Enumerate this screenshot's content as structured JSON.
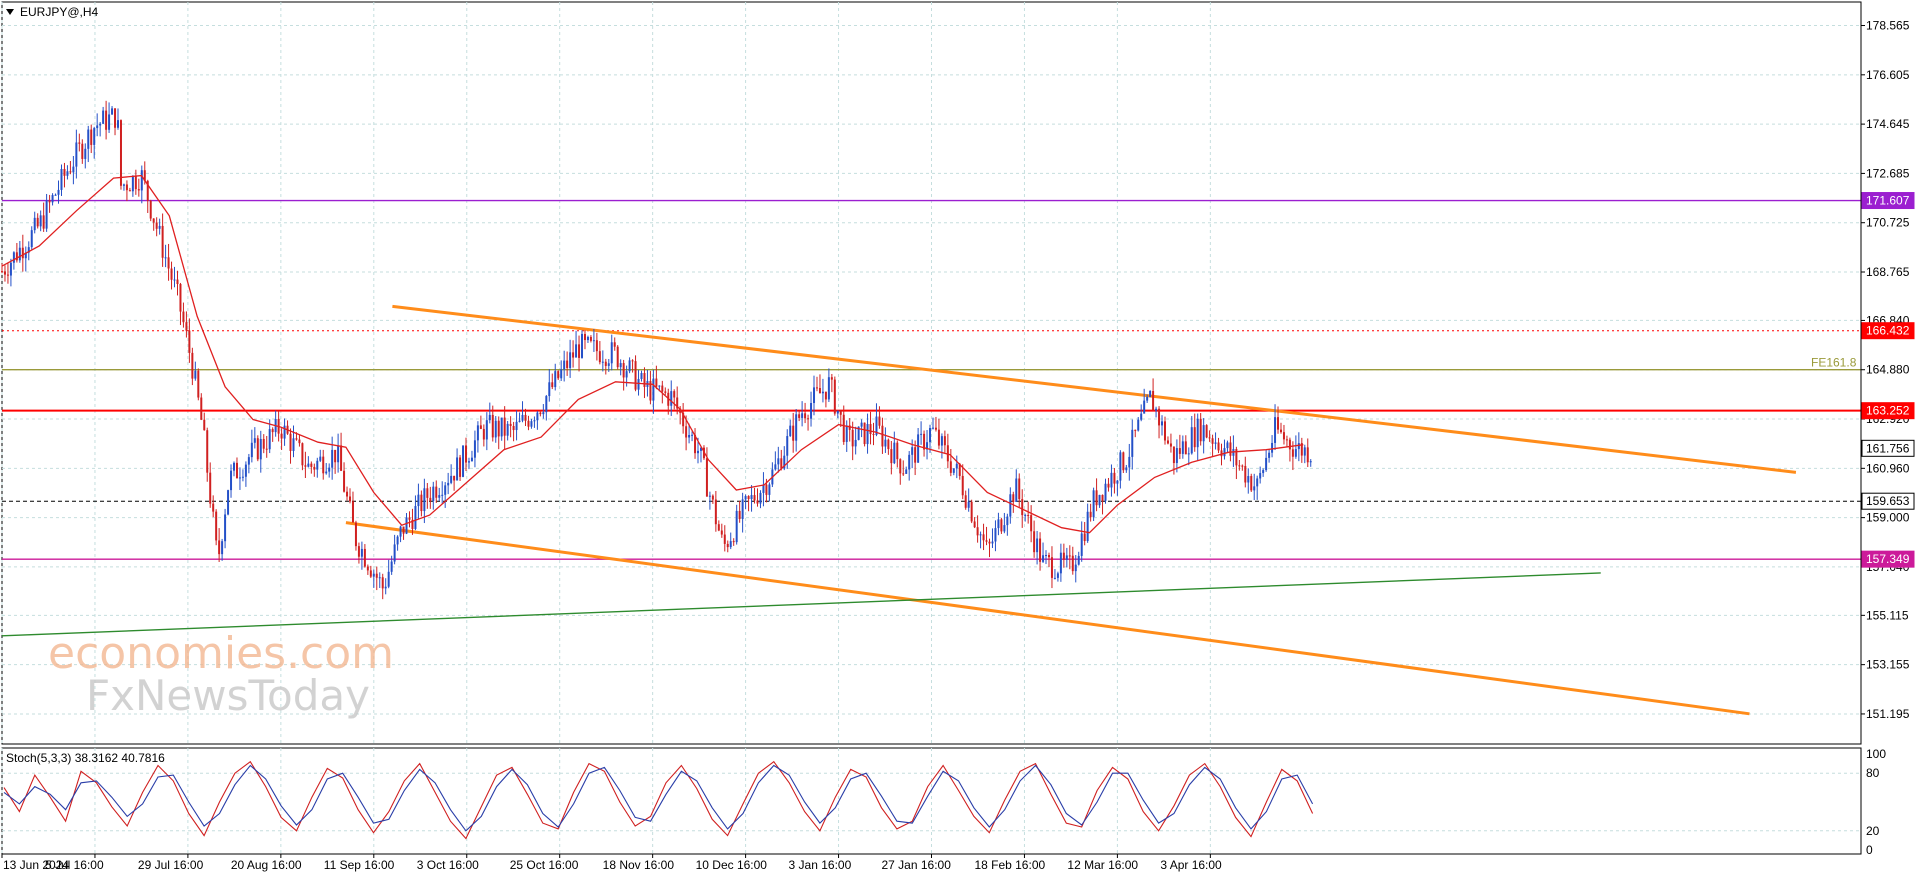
{
  "window": {
    "symbol_label": "EURJPY@,H4",
    "collapse_icon": "triangle-down-icon"
  },
  "watermark": {
    "line1": "economies.com",
    "line2": "FxNewsToday"
  },
  "colors": {
    "background": "#ffffff",
    "grid": "#c5dede",
    "bull_candle": "#2450c8",
    "bear_candle": "#d02020",
    "moving_average": "#e02020",
    "channel": "#ff8c1a",
    "support_trend": "#2e8b2e",
    "level_purple": "#9b1fd0",
    "level_red": "#ff0000",
    "level_magenta": "#cc1a9a",
    "level_olive": "#9a9a3a",
    "stoch_main": "#d02020",
    "stoch_signal": "#2a3ea8"
  },
  "chart_data": [
    {
      "type": "candlestick",
      "title": "EURJPY@,H4",
      "ylim": [
        150.0,
        179.5
      ],
      "xlim": [
        0,
        100
      ],
      "y_ticks": [
        178.565,
        176.605,
        174.645,
        172.685,
        170.725,
        168.765,
        166.84,
        164.88,
        162.92,
        160.96,
        159.0,
        157.04,
        155.115,
        153.155,
        151.195
      ],
      "x_tick_positions": [
        0,
        5,
        10,
        15,
        20,
        25,
        30,
        35,
        40,
        45,
        50,
        55,
        60,
        65
      ],
      "x_tick_labels": [
        "13 Jun 2024",
        "5 Jul 16:00",
        "29 Jul 16:00",
        "20 Aug 16:00",
        "11 Sep 16:00",
        "3 Oct 16:00",
        "25 Oct 16:00",
        "18 Nov 16:00",
        "10 Dec 16:00",
        "3 Jan 16:00",
        "27 Jan 16:00",
        "18 Feb 16:00",
        "12 Mar 16:00",
        "3 Apr 16:00"
      ],
      "price_path": [
        {
          "x": 0,
          "y": 168.8
        },
        {
          "x": 2,
          "y": 170.6
        },
        {
          "x": 3.5,
          "y": 172.8
        },
        {
          "x": 5,
          "y": 174.6
        },
        {
          "x": 6.2,
          "y": 175.0
        },
        {
          "x": 6.4,
          "y": 172.2
        },
        {
          "x": 7.5,
          "y": 172.6
        },
        {
          "x": 8.3,
          "y": 170.6
        },
        {
          "x": 9.5,
          "y": 167.6
        },
        {
          "x": 10.2,
          "y": 165.2
        },
        {
          "x": 10.8,
          "y": 162.5
        },
        {
          "x": 11.6,
          "y": 157.2
        },
        {
          "x": 12.2,
          "y": 160.5
        },
        {
          "x": 13.5,
          "y": 161.6
        },
        {
          "x": 15,
          "y": 162.6
        },
        {
          "x": 16.5,
          "y": 161.0
        },
        {
          "x": 18,
          "y": 161.6
        },
        {
          "x": 19,
          "y": 158.2
        },
        {
          "x": 20.5,
          "y": 156.2
        },
        {
          "x": 21.5,
          "y": 158.5
        },
        {
          "x": 23,
          "y": 160.0
        },
        {
          "x": 24.5,
          "y": 161.0
        },
        {
          "x": 26,
          "y": 162.6
        },
        {
          "x": 27.5,
          "y": 162.4
        },
        {
          "x": 29,
          "y": 163.5
        },
        {
          "x": 31,
          "y": 165.8
        },
        {
          "x": 33,
          "y": 165.5
        },
        {
          "x": 34.5,
          "y": 164.2
        },
        {
          "x": 36,
          "y": 163.8
        },
        {
          "x": 37.5,
          "y": 161.6
        },
        {
          "x": 38.8,
          "y": 157.8
        },
        {
          "x": 40,
          "y": 159.4
        },
        {
          "x": 41.5,
          "y": 160.8
        },
        {
          "x": 43,
          "y": 163.2
        },
        {
          "x": 44.5,
          "y": 164.3
        },
        {
          "x": 45.5,
          "y": 162.0
        },
        {
          "x": 47,
          "y": 162.6
        },
        {
          "x": 48.5,
          "y": 161.0
        },
        {
          "x": 50,
          "y": 162.5
        },
        {
          "x": 51.5,
          "y": 160.6
        },
        {
          "x": 53,
          "y": 157.6
        },
        {
          "x": 54.5,
          "y": 160.2
        },
        {
          "x": 56,
          "y": 157.2
        },
        {
          "x": 57.5,
          "y": 157.0
        },
        {
          "x": 58.8,
          "y": 159.8
        },
        {
          "x": 60.5,
          "y": 161.4
        },
        {
          "x": 61.8,
          "y": 163.8
        },
        {
          "x": 63,
          "y": 161.4
        },
        {
          "x": 64.5,
          "y": 162.6
        },
        {
          "x": 66,
          "y": 161.6
        },
        {
          "x": 67.5,
          "y": 160.2
        },
        {
          "x": 68.5,
          "y": 162.5
        },
        {
          "x": 69.5,
          "y": 161.8
        },
        {
          "x": 70.5,
          "y": 161.6
        }
      ],
      "moving_average": [
        {
          "x": 0,
          "y": 169.0
        },
        {
          "x": 2,
          "y": 169.8
        },
        {
          "x": 4,
          "y": 171.2
        },
        {
          "x": 6,
          "y": 172.5
        },
        {
          "x": 7.5,
          "y": 172.6
        },
        {
          "x": 9,
          "y": 171.0
        },
        {
          "x": 10.5,
          "y": 167.0
        },
        {
          "x": 12,
          "y": 164.2
        },
        {
          "x": 13.5,
          "y": 162.9
        },
        {
          "x": 15,
          "y": 162.6
        },
        {
          "x": 17,
          "y": 162.0
        },
        {
          "x": 18.5,
          "y": 161.8
        },
        {
          "x": 20,
          "y": 160.0
        },
        {
          "x": 21.5,
          "y": 158.7
        },
        {
          "x": 23,
          "y": 159.1
        },
        {
          "x": 25,
          "y": 160.4
        },
        {
          "x": 27,
          "y": 161.7
        },
        {
          "x": 29,
          "y": 162.2
        },
        {
          "x": 31,
          "y": 163.7
        },
        {
          "x": 33,
          "y": 164.4
        },
        {
          "x": 35,
          "y": 164.3
        },
        {
          "x": 36.5,
          "y": 163.3
        },
        {
          "x": 38,
          "y": 161.3
        },
        {
          "x": 39.5,
          "y": 160.1
        },
        {
          "x": 41,
          "y": 160.3
        },
        {
          "x": 43,
          "y": 161.7
        },
        {
          "x": 45,
          "y": 162.7
        },
        {
          "x": 47,
          "y": 162.4
        },
        {
          "x": 49,
          "y": 161.9
        },
        {
          "x": 51,
          "y": 161.5
        },
        {
          "x": 53,
          "y": 160.0
        },
        {
          "x": 55,
          "y": 159.3
        },
        {
          "x": 57,
          "y": 158.6
        },
        {
          "x": 58.5,
          "y": 158.4
        },
        {
          "x": 60,
          "y": 159.5
        },
        {
          "x": 62,
          "y": 160.6
        },
        {
          "x": 64,
          "y": 161.2
        },
        {
          "x": 66,
          "y": 161.6
        },
        {
          "x": 68,
          "y": 161.7
        },
        {
          "x": 70,
          "y": 161.9
        }
      ],
      "horizontal_levels": [
        {
          "price": "171.607",
          "value": 171.607,
          "style": "solid",
          "color": "#9b1fd0"
        },
        {
          "price": "166.432",
          "value": 166.432,
          "style": "dotted",
          "color": "#ff0000"
        },
        {
          "price": "FE161.8",
          "value": 164.88,
          "style": "solid",
          "color": "#9a9a3a"
        },
        {
          "price": "163.252",
          "value": 163.252,
          "style": "solid",
          "color": "#ff0000"
        },
        {
          "price": "161.756",
          "value": 161.756,
          "style": "tag",
          "color": "#000000"
        },
        {
          "price": "159.653",
          "value": 159.653,
          "style": "dashed",
          "color": "#000000"
        },
        {
          "price": "157.349",
          "value": 157.349,
          "style": "solid",
          "color": "#cc1a9a"
        }
      ],
      "trend_lines": [
        {
          "role": "channel-upper",
          "from": {
            "x": 21,
            "y": 167.4
          },
          "to": {
            "x": 96.5,
            "y": 160.8
          }
        },
        {
          "role": "channel-lower",
          "from": {
            "x": 18.5,
            "y": 158.8
          },
          "to": {
            "x": 94,
            "y": 151.2
          }
        },
        {
          "role": "support-trend",
          "from": {
            "x": 0,
            "y": 154.3
          },
          "to": {
            "x": 86,
            "y": 156.8
          }
        }
      ],
      "grid": true
    },
    {
      "type": "line",
      "title": "Stoch(5,3,3) 38.3162 40.7816",
      "ylim": [
        0,
        100
      ],
      "y_ticks": [
        0,
        20,
        80,
        100
      ],
      "series": [
        {
          "values": [
            65,
            40,
            78,
            55,
            30,
            82,
            70,
            45,
            25,
            60,
            88,
            72,
            38,
            15,
            50,
            80,
            92,
            66,
            34,
            20,
            55,
            85,
            75,
            42,
            18,
            40,
            72,
            90,
            60,
            30,
            12,
            45,
            78,
            86,
            58,
            28,
            22,
            60,
            90,
            82,
            50,
            25,
            35,
            70,
            88,
            64,
            32,
            15,
            48,
            80,
            92,
            70,
            40,
            20,
            55,
            84,
            76,
            44,
            22,
            30,
            66,
            88,
            62,
            35,
            18,
            52,
            82,
            90,
            58,
            28,
            24,
            62,
            86,
            74,
            40,
            20,
            46,
            78,
            90,
            66,
            34,
            14,
            50,
            84,
            72,
            38
          ]
        },
        {
          "values": [
            60,
            48,
            66,
            58,
            42,
            70,
            72,
            55,
            35,
            48,
            76,
            78,
            50,
            25,
            38,
            68,
            88,
            74,
            46,
            26,
            42,
            74,
            80,
            55,
            28,
            32,
            62,
            84,
            70,
            42,
            20,
            35,
            66,
            84,
            68,
            38,
            24,
            48,
            80,
            86,
            62,
            34,
            30,
            58,
            82,
            72,
            44,
            22,
            38,
            70,
            88,
            78,
            50,
            28,
            44,
            74,
            80,
            56,
            30,
            28,
            56,
            82,
            72,
            44,
            24,
            42,
            72,
            88,
            68,
            38,
            26,
            50,
            80,
            80,
            52,
            28,
            38,
            68,
            86,
            74,
            44,
            22,
            40,
            74,
            78,
            48
          ]
        }
      ]
    }
  ]
}
